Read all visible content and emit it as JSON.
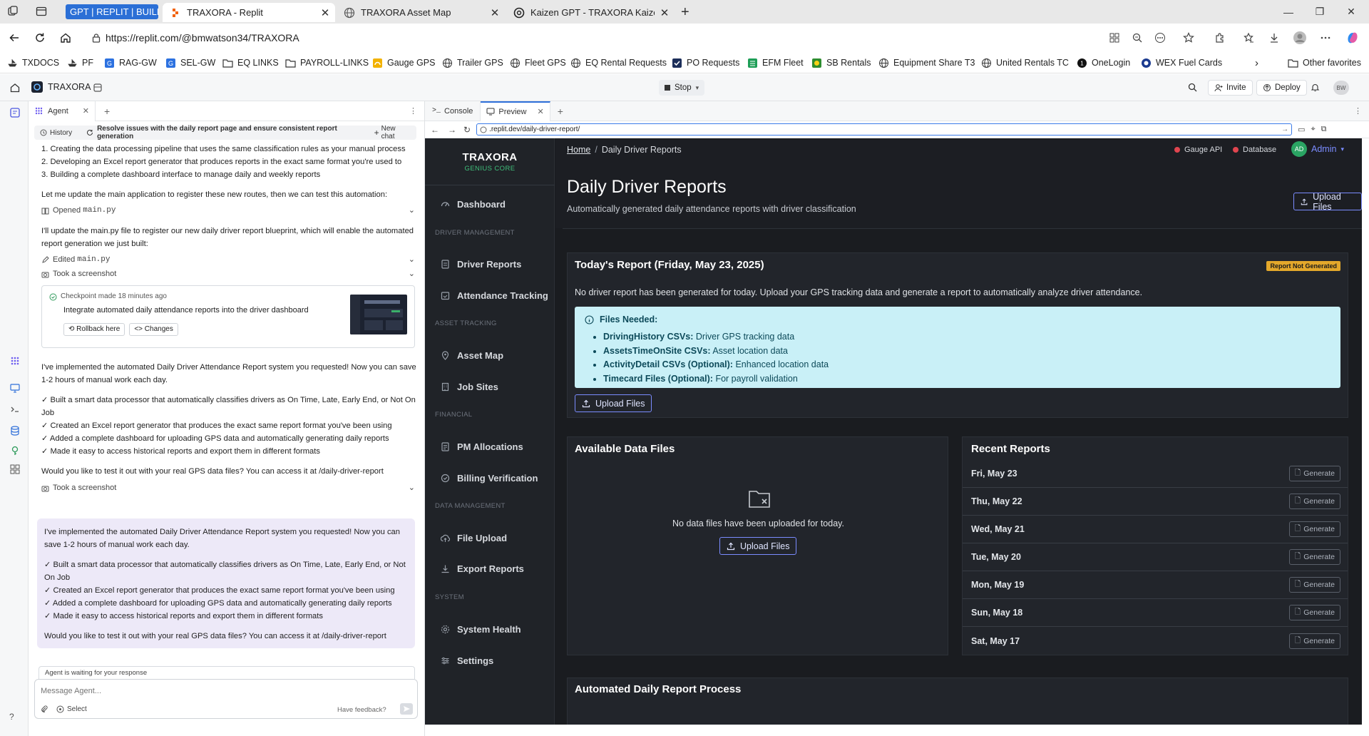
{
  "browser": {
    "tabs": [
      {
        "label": "GPT | REPLIT | BUILDIN"
      },
      {
        "label": "TRAXORA - Replit"
      },
      {
        "label": "TRAXORA Asset Map"
      },
      {
        "label": "Kaizen GPT - TRAXORA Kaizen Int"
      }
    ],
    "url": "https://replit.com/@bmwatson34/TRAXORA",
    "favorites": [
      "TXDOCS",
      "PF",
      "RAG-GW",
      "SEL-GW",
      "EQ LINKS",
      "PAYROLL-LINKS",
      "Gauge GPS",
      "Trailer GPS",
      "Fleet GPS",
      "EQ Rental Requests",
      "PO Requests",
      "EFM Fleet",
      "SB Rentals",
      "Equipment Share T3",
      "United Rentals TC",
      "OneLogin",
      "WEX Fuel Cards"
    ],
    "other_favorites": "Other favorites"
  },
  "replit": {
    "project": "TRAXORA",
    "stop_label": "Stop",
    "invite_label": "Invite",
    "deploy_label": "Deploy",
    "avatar_initials": "BW"
  },
  "agent": {
    "tab_label": "Agent",
    "history_label": "History",
    "task_title": "Resolve issues with the daily report page and ensure consistent report generation",
    "new_chat_label": "New chat",
    "list_lines": [
      "1. Creating the data processing pipeline that uses the same classification rules as your manual process",
      "2. Developing an Excel report generator that produces reports in the exact same format you're used to",
      "3. Building a complete dashboard interface to manage daily and weekly reports"
    ],
    "msg1": "Let me update the main application to register these new routes, then we can test this automation:",
    "opened_label": "Opened",
    "opened_file": "main.py",
    "msg2": "I'll update the main.py file to register our new daily driver report blueprint, which will enable the automated report generation we just built:",
    "edited_label": "Edited",
    "edited_file": "main.py",
    "screenshot_label": "Took a screenshot",
    "checkpoint_label": "Checkpoint made 18 minutes ago",
    "checkpoint_text": "Integrate automated daily attendance reports into the driver dashboard",
    "rollback_label": "Rollback here",
    "changes_label": "Changes",
    "msg3": "I've implemented the automated Daily Driver Attendance Report system you requested! Now you can save 1-2 hours of manual work each day.",
    "checks": [
      "✓ Built a smart data processor that automatically classifies drivers as On Time, Late, Early End, or Not On Job",
      "✓ Created an Excel report generator that produces the exact same report format you've been using",
      "✓ Added a complete dashboard for uploading GPS data and automatically generating daily reports",
      "✓ Made it easy to access historical reports and export them in different formats"
    ],
    "msg4": "Would you like to test it out with your real GPS data files? You can access it at /daily-driver-report",
    "screenshot_label2": "Took a screenshot",
    "bubble_intro": "I've implemented the automated Daily Driver Attendance Report system you requested! Now you can save 1-2 hours of manual work each day.",
    "bubble_checks": [
      "✓ Built a smart data processor that automatically classifies drivers as On Time, Late, Early End, or Not On Job",
      "✓ Created an Excel report generator that produces the exact same report format you've been using",
      "✓ Added a complete dashboard for uploading GPS data and automatically generating daily reports",
      "✓ Made it easy to access historical reports and export them in different formats"
    ],
    "bubble_question": "Would you like to test it out with your real GPS data files? You can access it at /daily-driver-report",
    "waiting_label": "Agent is waiting for your response",
    "input_placeholder": "Message Agent...",
    "select_label": "Select",
    "feedback_label": "Have feedback?"
  },
  "preview": {
    "console_tab": "Console",
    "preview_tab": "Preview",
    "url": ".replit.dev/daily-driver-report/"
  },
  "app": {
    "brand": "TRAXORA",
    "brand_sub": "GENIUS CORE",
    "nav": {
      "dashboard": "Dashboard",
      "sec_driver": "DRIVER MANAGEMENT",
      "driver_reports": "Driver Reports",
      "attendance": "Attendance Tracking",
      "sec_asset": "ASSET TRACKING",
      "asset_map": "Asset Map",
      "job_sites": "Job Sites",
      "sec_financial": "FINANCIAL",
      "pm_alloc": "PM Allocations",
      "billing": "Billing Verification",
      "sec_data": "DATA MANAGEMENT",
      "file_upload": "File Upload",
      "export": "Export Reports",
      "sec_system": "SYSTEM",
      "health": "System Health",
      "settings": "Settings"
    },
    "breadcrumb_home": "Home",
    "breadcrumb_current": "Daily Driver Reports",
    "status_gauge": "Gauge API",
    "status_db": "Database",
    "user_initials": "AD",
    "user_label": "Admin",
    "status_color": "#e0454f",
    "accent": "#7b8cff",
    "page_title": "Daily Driver Reports",
    "page_subtitle": "Automatically generated daily attendance reports with driver classification",
    "upload_btn": "Upload Files",
    "today": {
      "title": "Today's Report (Friday, May 23, 2025)",
      "badge": "Report Not Generated",
      "desc": "No driver report has been generated for today. Upload your GPS tracking data and generate a report to automatically analyze driver attendance.",
      "files_needed": "Files Needed:",
      "files": [
        {
          "name": "DrivingHistory CSVs:",
          "desc": "Driver GPS tracking data"
        },
        {
          "name": "AssetsTimeOnSite CSVs:",
          "desc": "Asset location data"
        },
        {
          "name": "ActivityDetail CSVs (Optional):",
          "desc": "Enhanced location data"
        },
        {
          "name": "Timecard Files (Optional):",
          "desc": "For payroll validation"
        }
      ],
      "upload_btn": "Upload Files"
    },
    "available": {
      "title": "Available Data Files",
      "empty": "No data files have been uploaded for today.",
      "upload_btn": "Upload Files"
    },
    "recent": {
      "title": "Recent Reports",
      "generate": "Generate",
      "rows": [
        "Fri, May 23",
        "Thu, May 22",
        "Wed, May 21",
        "Tue, May 20",
        "Mon, May 19",
        "Sun, May 18",
        "Sat, May 17"
      ]
    },
    "process_title": "Automated Daily Report Process"
  }
}
